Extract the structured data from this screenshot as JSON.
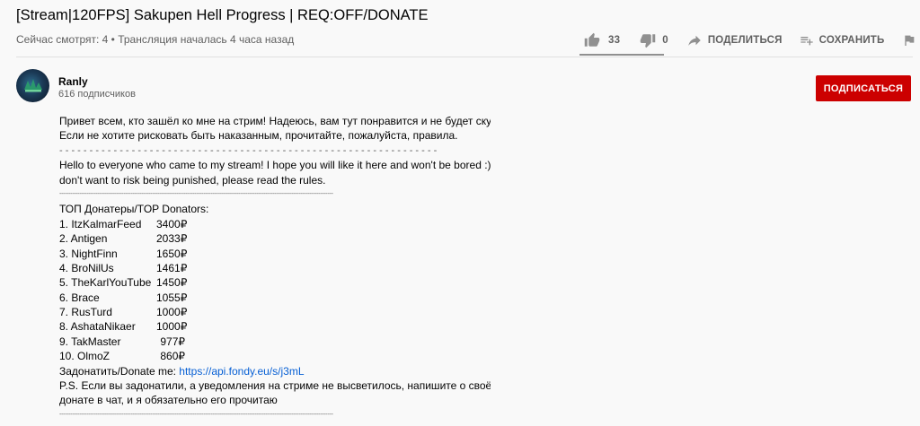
{
  "video": {
    "title": "[Stream|120FPS] Sakupen Hell Progress | REQ:OFF/DONATE",
    "meta": "Сейчас смотрят: 4 • Трансляция началась 4 часа назад"
  },
  "actions": {
    "like_count": "33",
    "dislike_count": "0",
    "share_label": "ПОДЕЛИТЬСЯ",
    "save_label": "СОХРАНИТЬ",
    "like_ratio": 1.0
  },
  "channel": {
    "name": "Ranly",
    "subscribers": "616 подписчиков",
    "subscribe_label": "ПОДПИСАТЬСЯ",
    "accent_color": "#cc0000"
  },
  "description": {
    "ru_line1": "Привет всем, кто зашёл ко мне на стрим! Надеюсь, вам тут понравится и не будет скучно :)",
    "ru_line2": "Если не хотите рисковать быть наказанным, прочитайте, пожалуйста, правила.",
    "sep1": "- - - - - - - - - - - - - - - - - - - - - - - - - - - - - - - - - - - - - - - - - - - - - - - - - - - - - - - - - - - - - - -",
    "en_line1": "Hello to everyone who came to my stream! I hope you will like it here and won't be bored :) If you",
    "en_line2": "don't want to risk being punished, please read the rules.",
    "sep2": "------------------------------------------------------------------------------------------------------------------------------------------------------",
    "top_heading": "ТОП Донатеры/TOP Donators:",
    "donators": [
      {
        "name": "1. ItzKalmarFeed",
        "amount": "3400₽"
      },
      {
        "name": "2. Antigen",
        "amount": "2033₽"
      },
      {
        "name": "3. NightFinn",
        "amount": "1650₽"
      },
      {
        "name": "4. BroNilUs",
        "amount": "1461₽"
      },
      {
        "name": "5. TheKarlYouTube",
        "amount": "1450₽"
      },
      {
        "name": "6. Brace",
        "amount": "1055₽"
      },
      {
        "name": "7. RusTurd",
        "amount": "1000₽"
      },
      {
        "name": "8. AshataNikaer",
        "amount": "1000₽"
      },
      {
        "name": "9. TakMaster",
        "amount": "977₽"
      },
      {
        "name": "10. OlmoZ",
        "amount": "860₽"
      }
    ],
    "donate_label": "Задонатить/Donate me: ",
    "donate_link": "https://api.fondy.eu/s/j3mL",
    "ps_line1": "P.S. Если вы задонатили, а уведомления на стриме не высветилось, напишите о своём",
    "ps_line2": "донате в чат, и я обязательно его прочитаю",
    "sep3": "------------------------------------------------------------------------------------------------------------------------------------------------------"
  },
  "icons": {
    "like": "thumb-up-icon",
    "dislike": "thumb-down-icon",
    "share": "share-arrow-icon",
    "save": "playlist-add-icon",
    "report": "flag-icon",
    "more": "more-horizontal-icon"
  }
}
